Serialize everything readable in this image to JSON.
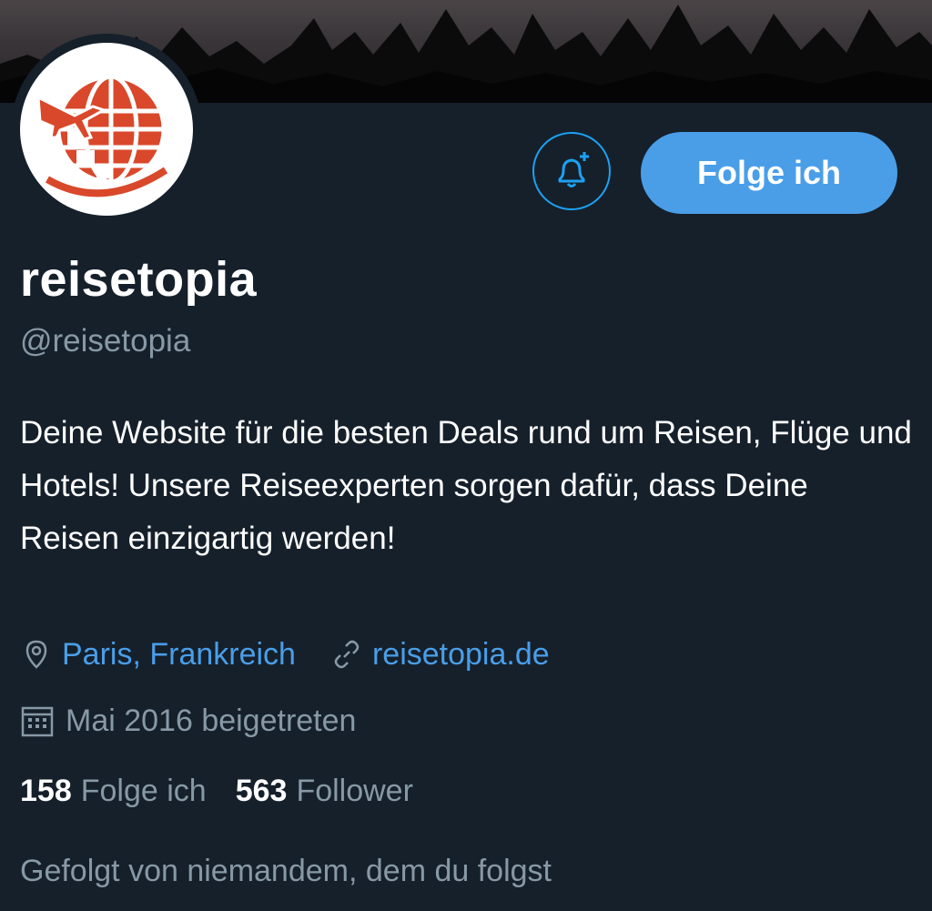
{
  "profile": {
    "name": "reisetopia",
    "handle": "@reisetopia",
    "bio": "Deine Website für die besten Deals rund um Reisen, Flüge und Hotels! Unsere Reiseexperten sorgen dafür, dass Deine Reisen einzigartig werden!",
    "location": "Paris, Frankreich",
    "website": "reisetopia.de",
    "joined": "Mai 2016 beigetreten",
    "followed_by": "Gefolgt von niemandem, dem du folgst"
  },
  "actions": {
    "follow_label": "Folge ich",
    "notify_icon": "bell-plus-icon"
  },
  "stats": {
    "following_count": "158",
    "following_label": "Folge ich",
    "followers_count": "563",
    "followers_label": "Follower"
  },
  "icons": {
    "location": "location-pin-icon",
    "link": "link-icon",
    "calendar": "calendar-icon"
  },
  "colors": {
    "background": "#15202b",
    "accent": "#4a9ee8",
    "secondary_text": "#8899a6",
    "logo_red": "#d9482b"
  }
}
